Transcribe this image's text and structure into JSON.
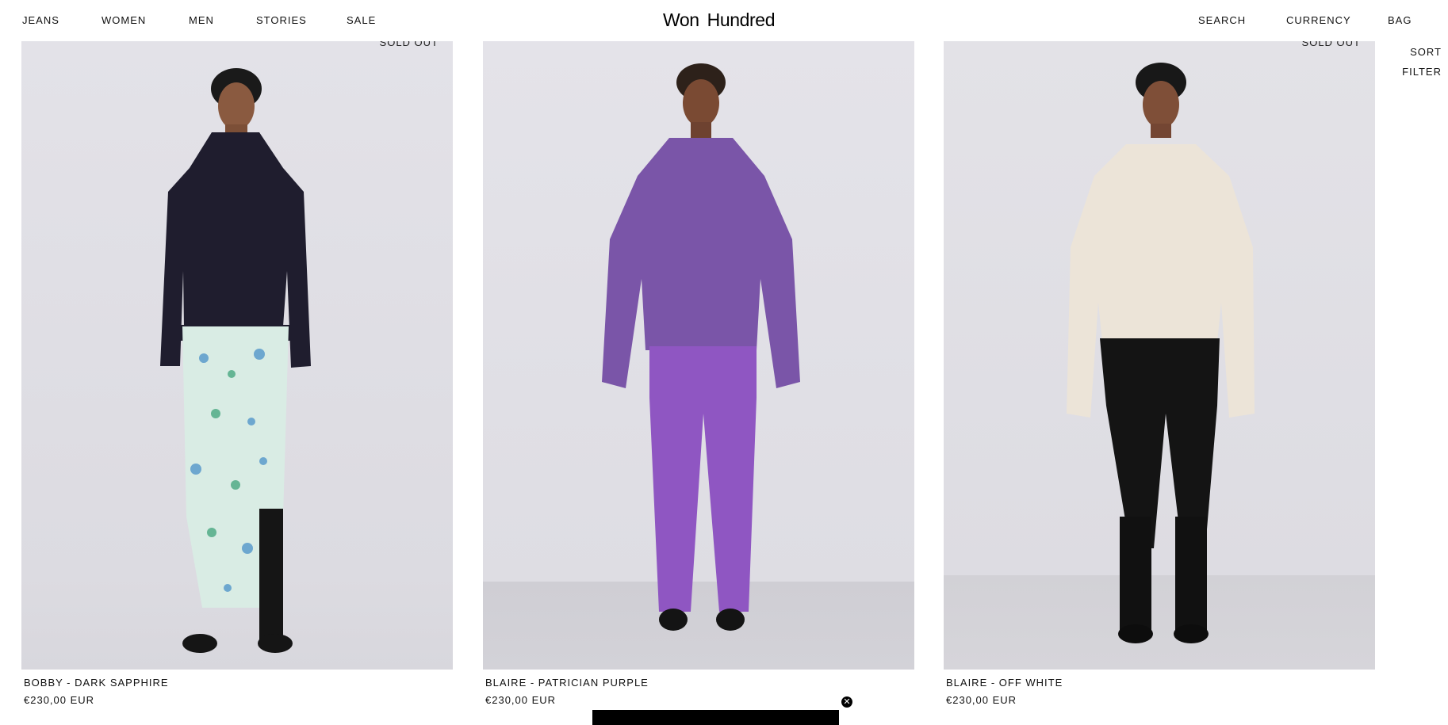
{
  "nav": {
    "left": [
      "JEANS",
      "WOMEN",
      "MEN",
      "STORIES",
      "SALE"
    ],
    "right": [
      "SEARCH",
      "CURRENCY",
      "BAG"
    ],
    "logo": "Won Hundred"
  },
  "controls": {
    "sort": "SORT",
    "filter": "FILTER"
  },
  "products": [
    {
      "name": "BOBBY - DARK SAPPHIRE",
      "price": "€230,00 EUR",
      "badge": "SOLD OUT",
      "top_color": "#1f1d2e",
      "bottom_color": "#d9ece4",
      "bottom_pattern": "floral"
    },
    {
      "name": "BLAIRE - PATRICIAN PURPLE",
      "price": "€230,00 EUR",
      "badge": "",
      "top_color": "#7a55a8",
      "bottom_color": "#8f56c2",
      "bottom_pattern": "solid"
    },
    {
      "name": "BLAIRE - OFF WHITE",
      "price": "€230,00 EUR",
      "badge": "SOLD OUT",
      "top_color": "#ece4d8",
      "bottom_color": "#141414",
      "bottom_pattern": "leather"
    }
  ],
  "promo": {
    "close_icon": "close-icon"
  }
}
